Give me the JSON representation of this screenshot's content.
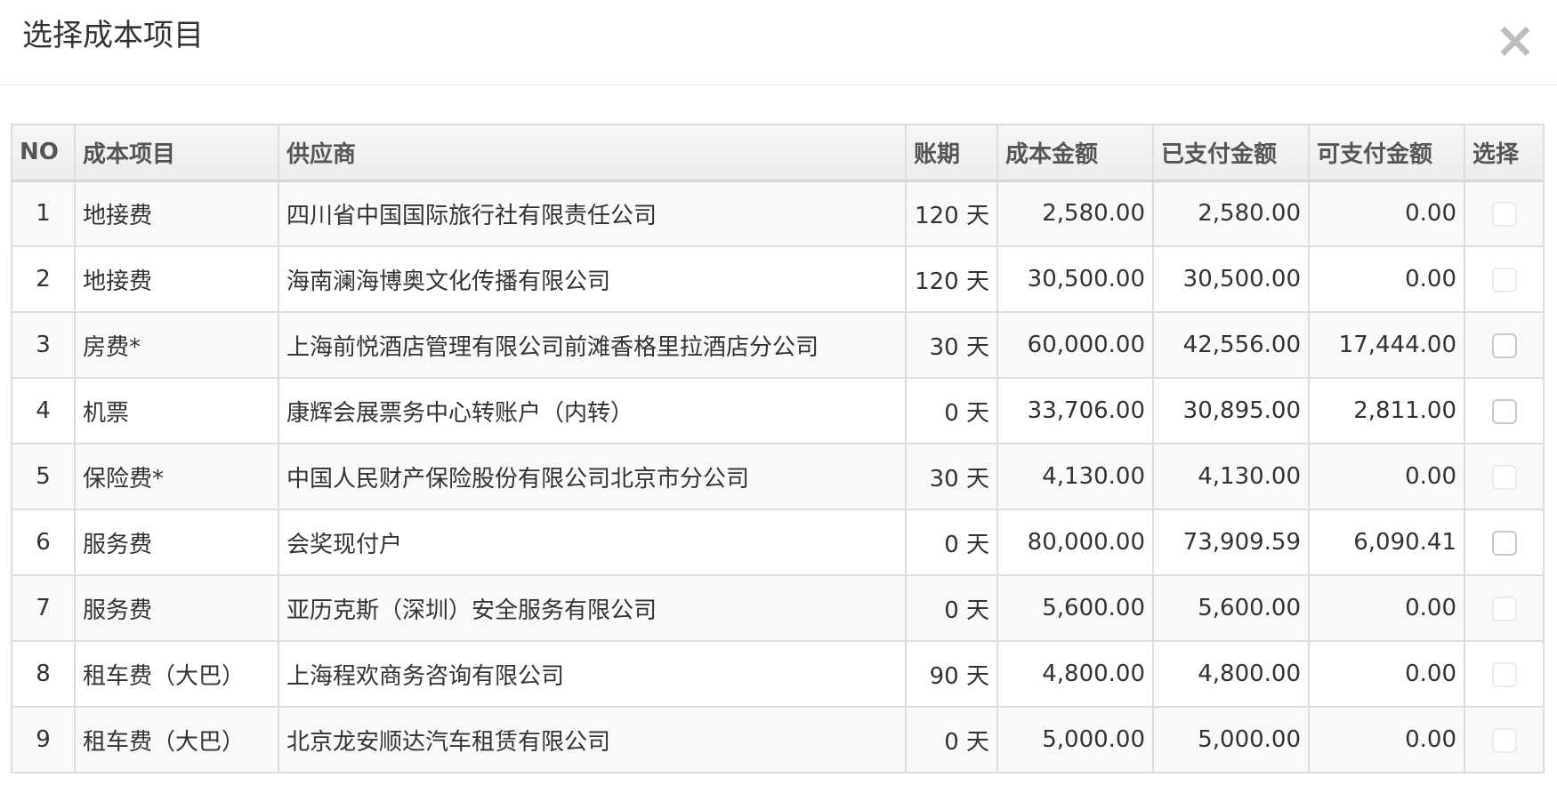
{
  "dialog": {
    "title": "选择成本项目",
    "close_icon": "×"
  },
  "table": {
    "headers": {
      "no": "NO",
      "item": "成本项目",
      "supplier": "供应商",
      "term": "账期",
      "cost": "成本金额",
      "paid": "已支付金额",
      "payable": "可支付金额",
      "select": "选择"
    },
    "rows": [
      {
        "no": "1",
        "item": "地接费",
        "supplier": "四川省中国国际旅行社有限责任公司",
        "term": "120 天",
        "cost": "2,580.00",
        "paid": "2,580.00",
        "payable": "0.00",
        "selectable": false
      },
      {
        "no": "2",
        "item": "地接费",
        "supplier": "海南澜海博奥文化传播有限公司",
        "term": "120 天",
        "cost": "30,500.00",
        "paid": "30,500.00",
        "payable": "0.00",
        "selectable": false
      },
      {
        "no": "3",
        "item": "房费*",
        "supplier": "上海前悦酒店管理有限公司前滩香格里拉酒店分公司",
        "term": "30 天",
        "cost": "60,000.00",
        "paid": "42,556.00",
        "payable": "17,444.00",
        "selectable": true
      },
      {
        "no": "4",
        "item": "机票",
        "supplier": "康辉会展票务中心转账户（内转）",
        "term": "0 天",
        "cost": "33,706.00",
        "paid": "30,895.00",
        "payable": "2,811.00",
        "selectable": true
      },
      {
        "no": "5",
        "item": "保险费*",
        "supplier": "中国人民财产保险股份有限公司北京市分公司",
        "term": "30 天",
        "cost": "4,130.00",
        "paid": "4,130.00",
        "payable": "0.00",
        "selectable": false
      },
      {
        "no": "6",
        "item": "服务费",
        "supplier": "会奖现付户",
        "term": "0 天",
        "cost": "80,000.00",
        "paid": "73,909.59",
        "payable": "6,090.41",
        "selectable": true
      },
      {
        "no": "7",
        "item": "服务费",
        "supplier": "亚历克斯（深圳）安全服务有限公司",
        "term": "0 天",
        "cost": "5,600.00",
        "paid": "5,600.00",
        "payable": "0.00",
        "selectable": false
      },
      {
        "no": "8",
        "item": "租车费（大巴）",
        "supplier": "上海程欢商务咨询有限公司",
        "term": "90 天",
        "cost": "4,800.00",
        "paid": "4,800.00",
        "payable": "0.00",
        "selectable": false
      },
      {
        "no": "9",
        "item": "租车费（大巴）",
        "supplier": "北京龙安顺达汽车租赁有限公司",
        "term": "0 天",
        "cost": "5,000.00",
        "paid": "5,000.00",
        "payable": "0.00",
        "selectable": false
      }
    ]
  }
}
